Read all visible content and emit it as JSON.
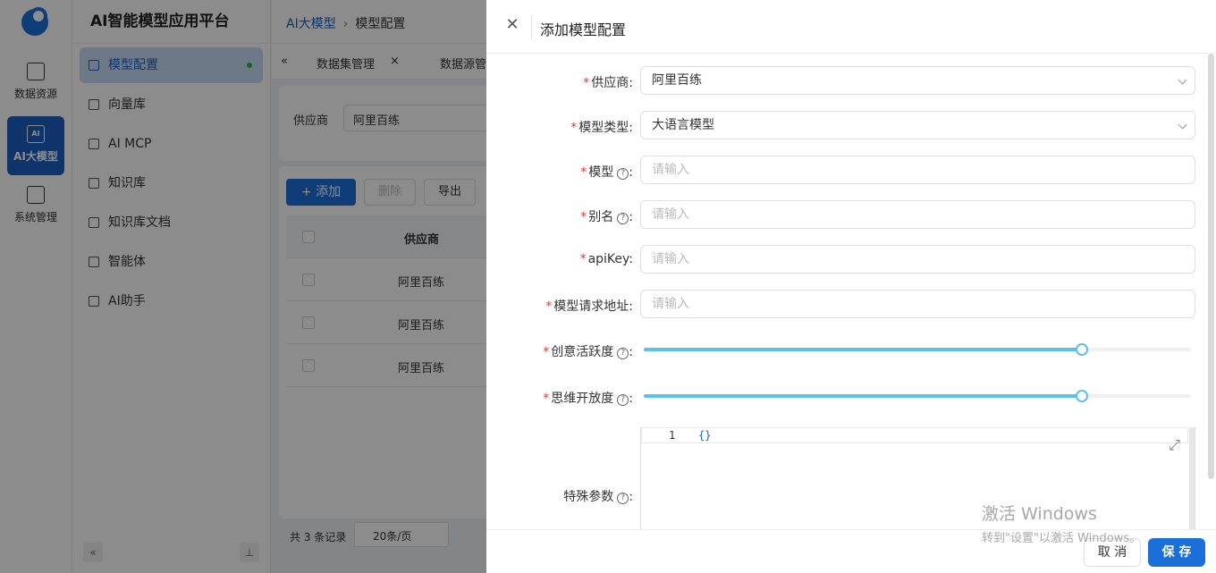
{
  "app": {
    "title": "AI智能模型应用平台"
  },
  "rail": {
    "items": [
      {
        "label": "数据资源",
        "icon": "database-icon"
      },
      {
        "label": "AI大模型",
        "icon": "ai-icon",
        "icon_text": "AI"
      },
      {
        "label": "系统管理",
        "icon": "settings-grid-icon"
      }
    ]
  },
  "menu": {
    "items": [
      {
        "label": "模型配置"
      },
      {
        "label": "向量库"
      },
      {
        "label": "AI MCP"
      },
      {
        "label": "知识库"
      },
      {
        "label": "知识库文档"
      },
      {
        "label": "智能体"
      },
      {
        "label": "AI助手"
      }
    ]
  },
  "breadcrumb": {
    "root": "AI大模型",
    "current": "模型配置"
  },
  "tabs": [
    {
      "label": "数据集管理"
    },
    {
      "label": "数据源管"
    }
  ],
  "filter": {
    "label": "供应商",
    "value": "阿里百练"
  },
  "toolbar": {
    "add": "+ 添加",
    "delete": "删除",
    "export": "导出"
  },
  "table": {
    "header": "供应商",
    "rows": [
      "阿里百练",
      "阿里百练",
      "阿里百练"
    ]
  },
  "pager": {
    "total": "共 3 条记录",
    "size": "20条/页"
  },
  "drawer": {
    "title": "添加模型配置",
    "fields": {
      "vendor": {
        "label": "供应商:",
        "value": "阿里百练"
      },
      "model_type": {
        "label": "模型类型:",
        "value": "大语言模型"
      },
      "model": {
        "label": "模型",
        "placeholder": "请输入"
      },
      "alias": {
        "label": "别名",
        "placeholder": "请输入"
      },
      "apikey": {
        "label": "apiKey:",
        "placeholder": "请输入"
      },
      "url": {
        "label": "模型请求地址:",
        "placeholder": "请输入"
      },
      "creativity": {
        "label": "创意活跃度",
        "value": 0.8
      },
      "openness": {
        "label": "思维开放度",
        "value": 0.8
      },
      "special": {
        "label": "特殊参数",
        "line_no": "1",
        "code": "{}"
      }
    },
    "help_glyph": "?",
    "colon": ":",
    "required_mark": "*",
    "cancel": "取 消",
    "save": "保 存"
  },
  "watermark": {
    "line1": "激活 Windows",
    "line2": "转到\"设置\"以激活 Windows。"
  },
  "colors": {
    "primary": "#1a6fd9",
    "slider": "#5bc0eb",
    "required": "#e53935"
  }
}
